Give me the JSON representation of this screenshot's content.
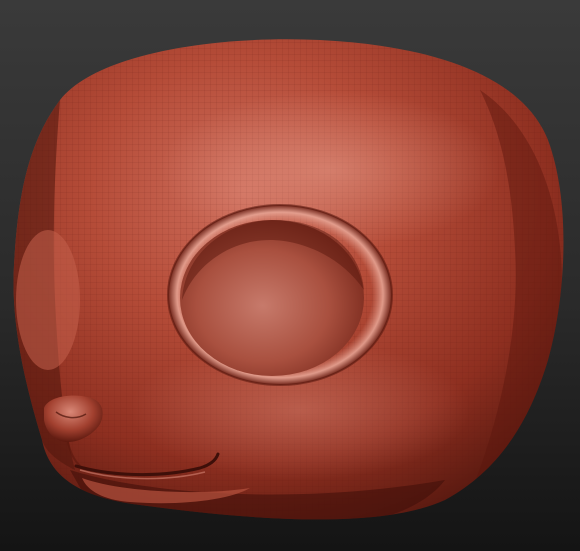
{
  "viewport": {
    "subject": "sculpt-head",
    "background_top": "#3a3a3a",
    "background_bottom": "#141414"
  },
  "material": {
    "base": "#a63a2a",
    "highlight": "#d98575",
    "shadow": "#3e0f09",
    "mesh_line": "#6b1f14"
  },
  "icons": {
    "model": "clay-head-model"
  }
}
